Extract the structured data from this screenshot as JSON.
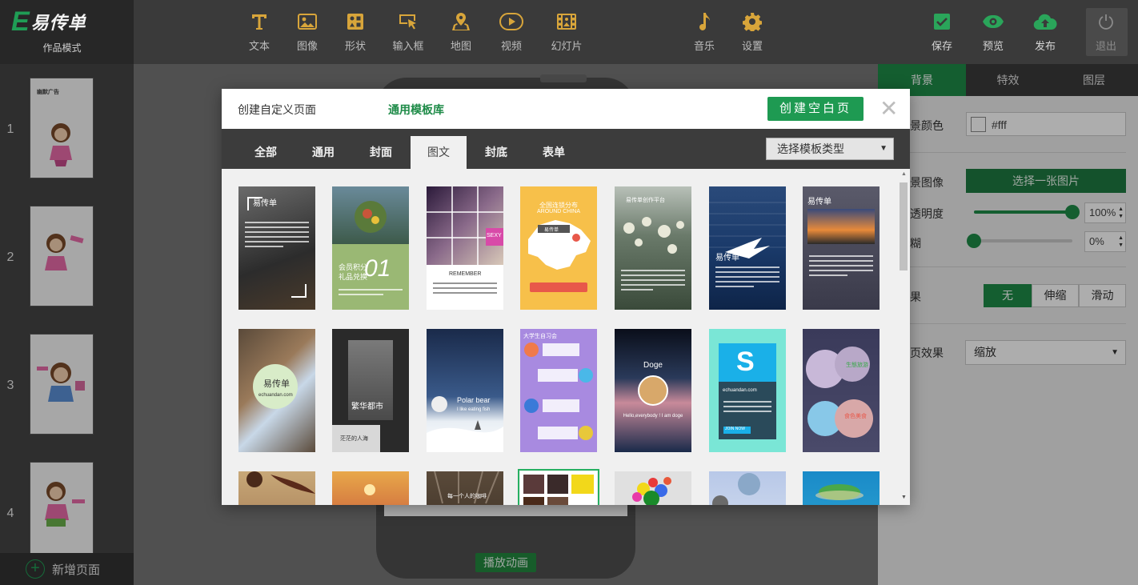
{
  "app": {
    "logo_letter": "E",
    "logo_text": "易传单",
    "mode": "作品模式"
  },
  "toolbar": {
    "text": "文本",
    "image": "图像",
    "shape": "形状",
    "input": "输入框",
    "map": "地图",
    "video": "视频",
    "slideshow": "幻灯片",
    "music": "音乐",
    "settings": "设置",
    "save": "保存",
    "preview": "预览",
    "publish": "发布",
    "exit": "退出"
  },
  "pages": [
    {
      "num": "1",
      "caption": "幽默广告"
    },
    {
      "num": "2",
      "caption": ""
    },
    {
      "num": "3",
      "caption": ""
    },
    {
      "num": "4",
      "caption": ""
    }
  ],
  "add_page": "新增页面",
  "play_animation": "播放动画",
  "right_panel": {
    "tabs": [
      "背景",
      "特效",
      "图层"
    ],
    "bg_color_label": "景颜色",
    "bg_color_value": "#fff",
    "bg_image_label": "景图像",
    "pick_image": "选择一张图片",
    "opacity_label": "透明度",
    "opacity_value": "100%",
    "opacity_level": 1.0,
    "blur_label": "糊",
    "blur_value": "0%",
    "blur_level": 0.0,
    "effect_label": "果",
    "effect_options": [
      "无",
      "伸缩",
      "滑动"
    ],
    "effect_selected": "无",
    "page_effect_label": "页效果",
    "page_effect_value": "缩放"
  },
  "modal": {
    "tab_custom": "创建自定义页面",
    "tab_library": "通用模板库",
    "create_blank": "创建空白页",
    "close": "✕",
    "categories": [
      "全部",
      "通用",
      "封面",
      "图文",
      "封底",
      "表单"
    ],
    "active_category": "图文",
    "type_select": "选择模板类型",
    "templates": [
      {
        "title": "易传单"
      },
      {
        "title": "会员积分",
        "subtitle": "礼品兑换",
        "big": "01"
      },
      {
        "title": "REMEMBER",
        "badge": "SEXY"
      },
      {
        "title": "全国连锁分布",
        "subtitle": "AROUND CHINA",
        "chip": "易传单"
      },
      {
        "title": "易传单创作平台"
      },
      {
        "title": "易传单"
      },
      {
        "title": "易传单"
      },
      {
        "title": "易传单",
        "subtitle": "echuandan.com"
      },
      {
        "title": "繁华都市",
        "subtitle": "茫茫的人海"
      },
      {
        "title": "Polar bear",
        "subtitle": "I like eating fish"
      },
      {
        "title": "大学生自习会"
      },
      {
        "title": "Doge",
        "subtitle": "Hello,everybody ! I am doge"
      },
      {
        "title": "S",
        "subtitle": "echuandan.com",
        "btn": "JOIN NOW"
      },
      {
        "title": "生態旅游",
        "subtitle": "食色美食"
      },
      {
        "title": ""
      },
      {
        "title": ""
      },
      {
        "title": "每一个人的咖啡"
      },
      {
        "title": ""
      },
      {
        "title": ""
      },
      {
        "title": ""
      },
      {
        "title": ""
      }
    ]
  },
  "colors": {
    "accent": "#1e8b48",
    "toolbar_bg": "#3a3a3a"
  }
}
